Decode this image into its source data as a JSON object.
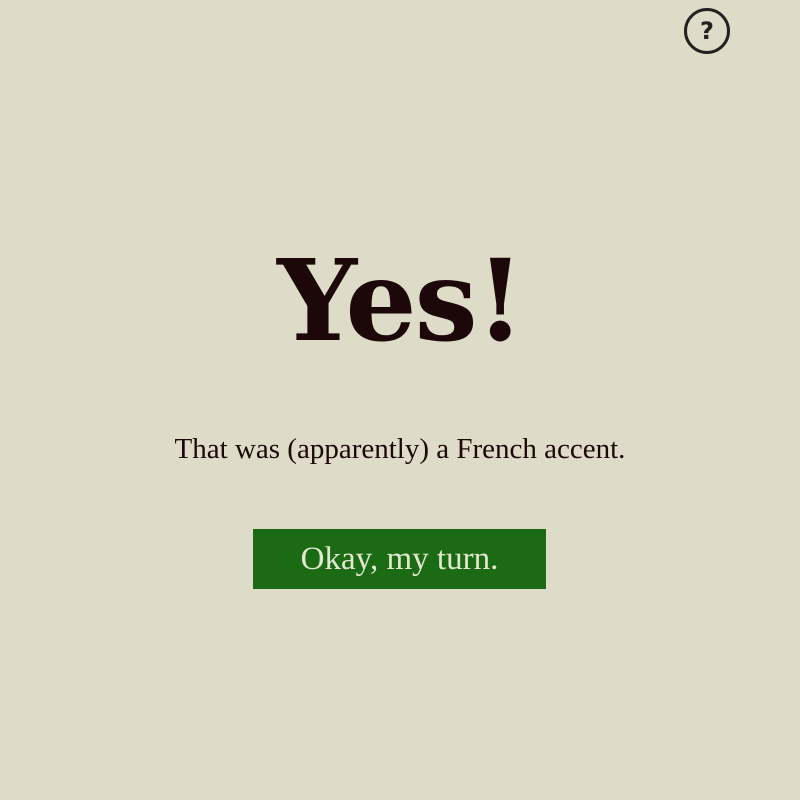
{
  "help": {
    "icon": "question-circle-icon",
    "glyph": "?"
  },
  "result": {
    "headline": "Yes!",
    "message": "That was (apparently) a French accent."
  },
  "action": {
    "label": "Okay, my turn."
  },
  "colors": {
    "background": "#dedbc8",
    "text": "#1c0808",
    "button_bg": "#1b6b14",
    "button_text": "#e3e7cf"
  }
}
